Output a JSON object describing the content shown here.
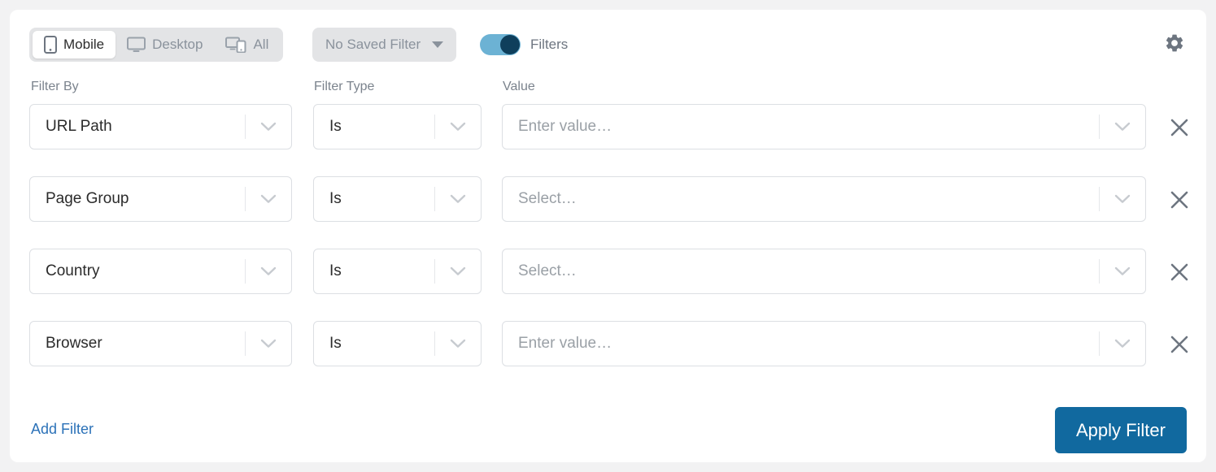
{
  "toolbar": {
    "devices": [
      {
        "label": "Mobile",
        "icon": "mobile-icon",
        "active": true
      },
      {
        "label": "Desktop",
        "icon": "desktop-icon",
        "active": false
      },
      {
        "label": "All",
        "icon": "all-devices-icon",
        "active": false
      }
    ],
    "saved_filter": {
      "label": "No Saved Filter",
      "icon": "caret-down-icon"
    },
    "filters_toggle": {
      "label": "Filters",
      "state": "on"
    },
    "settings": {
      "icon": "gear-icon"
    }
  },
  "columns": {
    "filter_by": "Filter By",
    "filter_type": "Filter Type",
    "value": "Value"
  },
  "rows": [
    {
      "filter_by": "URL Path",
      "filter_type": "Is",
      "value": "",
      "value_placeholder": "Enter value…"
    },
    {
      "filter_by": "Page Group",
      "filter_type": "Is",
      "value": "",
      "value_placeholder": "Select…"
    },
    {
      "filter_by": "Country",
      "filter_type": "Is",
      "value": "",
      "value_placeholder": "Select…"
    },
    {
      "filter_by": "Browser",
      "filter_type": "Is",
      "value": "",
      "value_placeholder": "Enter value…"
    }
  ],
  "footer": {
    "add_filter": "Add Filter",
    "apply_filter": "Apply Filter"
  },
  "colors": {
    "page_background": "#f2f2f3",
    "card_background": "#ffffff",
    "accent_button": "#11699f",
    "link": "#2c72b8",
    "toggle_track": "#6cb2d4",
    "toggle_knob": "#0f3f5c",
    "segment_background": "#e3e4e6",
    "muted_text": "#8a929c",
    "field_border": "#dcdfe3"
  }
}
